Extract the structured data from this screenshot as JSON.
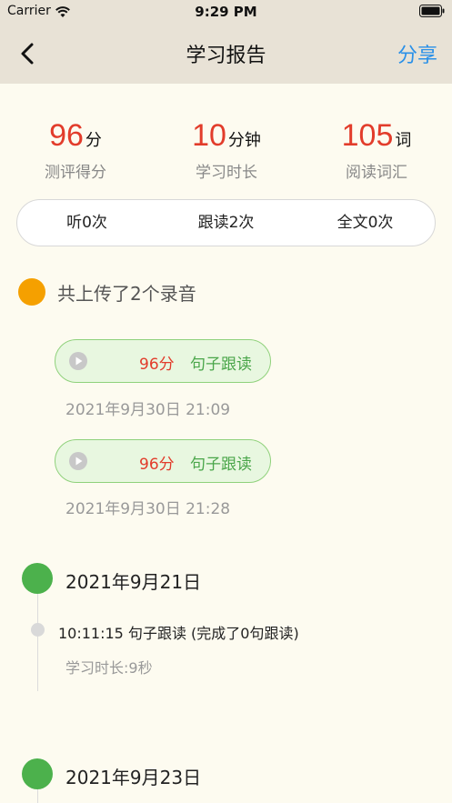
{
  "status_bar": {
    "carrier": "Carrier",
    "time": "9:29 PM"
  },
  "nav": {
    "title": "学习报告",
    "share": "分享"
  },
  "stats": [
    {
      "value": "96",
      "unit": "分",
      "label": "测评得分"
    },
    {
      "value": "10",
      "unit": "分钟",
      "label": "学习时长"
    },
    {
      "value": "105",
      "unit": "词",
      "label": "阅读词汇"
    }
  ],
  "counts": [
    "听0次",
    "跟读2次",
    "全文0次"
  ],
  "uploads": {
    "summary": "共上传了2个录音",
    "recordings": [
      {
        "score": "96分",
        "type": "句子跟读",
        "time": "2021年9月30日 21:09"
      },
      {
        "score": "96分",
        "type": "句子跟读",
        "time": "2021年9月30日 21:28"
      }
    ]
  },
  "timeline": [
    {
      "date": "2021年9月21日",
      "entry": "10:11:15 句子跟读 (完成了0句跟读)",
      "duration": "学习时长:9秒"
    },
    {
      "date": "2021年9月23日"
    }
  ],
  "colors": {
    "accent": "#2a90e8",
    "score": "#e23c2b",
    "green": "#4cb14c",
    "orange": "#f5a000"
  }
}
